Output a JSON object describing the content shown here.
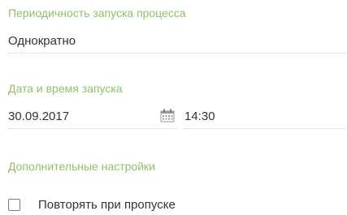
{
  "periodicity": {
    "label": "Периодичность запуска процесса",
    "value": "Однократно"
  },
  "start": {
    "label": "Дата и время запуска",
    "date_value": "30.09.2017",
    "time_value": "14:30",
    "calendar_icon": "calendar-icon"
  },
  "additional": {
    "label": "Дополнительные настройки",
    "repeat_on_skip": {
      "label": "Повторять при пропуске",
      "checked": false
    }
  },
  "colors": {
    "label_accent": "#8cc16b",
    "text": "#333333",
    "divider": "#c8c8c8"
  }
}
